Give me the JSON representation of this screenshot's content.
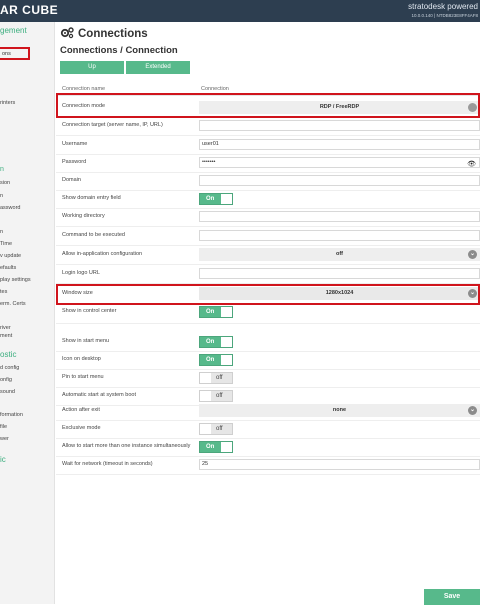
{
  "header": {
    "logo": "AR CUBE",
    "powered": "stratodesk powered",
    "version": "10.0.0.140 | NTDB823E8FF4AF8"
  },
  "sidebar": {
    "heading_management": "gement",
    "active_item": "ons",
    "items": [
      "rinters",
      "n",
      "sion",
      "n",
      "assword",
      "n",
      "Time",
      "v update",
      "efaults",
      "play settings",
      "tes",
      "erm. Certs",
      "river",
      "ment"
    ],
    "heading_diagnostic": "ostic",
    "diag_items": [
      "d config",
      "onfig",
      "sound",
      "formation",
      "file",
      "wer"
    ],
    "heading_misc": "ic"
  },
  "page": {
    "title": "Connections",
    "subtitle": "Connections / Connection",
    "btn_up": "Up",
    "btn_extended": "Extended"
  },
  "table": {
    "col_name": "Connection name",
    "col_value": "Connection",
    "rows": {
      "mode": {
        "label": "Connection mode",
        "value": "RDP / FreeRDP"
      },
      "target": {
        "label": "Connection target (server name, IP, URL)",
        "value": ""
      },
      "username": {
        "label": "Username",
        "value": "user01"
      },
      "password": {
        "label": "Password",
        "value": "•••••••"
      },
      "domain": {
        "label": "Domain",
        "value": ""
      },
      "show_domain": {
        "label": "Show domain entry field",
        "value": "On"
      },
      "workdir": {
        "label": "Working directory",
        "value": ""
      },
      "command": {
        "label": "Command to be executed",
        "value": ""
      },
      "inapp": {
        "label": "Allow in-application configuration",
        "value": "off"
      },
      "logo_url": {
        "label": "Login logo URL",
        "value": ""
      },
      "window_size": {
        "label": "Window size",
        "value": "1280x1024"
      },
      "control_center": {
        "label": "Show in control center",
        "value": "On"
      },
      "start_menu": {
        "label": "Show in start menu",
        "value": "On"
      },
      "desktop": {
        "label": "Icon on desktop",
        "value": "On"
      },
      "pin": {
        "label": "Pin to start menu",
        "value": "off"
      },
      "autostart": {
        "label": "Automatic start at system boot",
        "value": "off"
      },
      "after_exit": {
        "label": "Action after exit",
        "value": "none"
      },
      "exclusive": {
        "label": "Exclusive mode",
        "value": "off"
      },
      "multi": {
        "label": "Allow to start more than one instance simultaneously",
        "value": "On"
      },
      "wait_net": {
        "label": "Wait for network (timeout in seconds)",
        "value": "25"
      }
    }
  },
  "save_label": "Save"
}
